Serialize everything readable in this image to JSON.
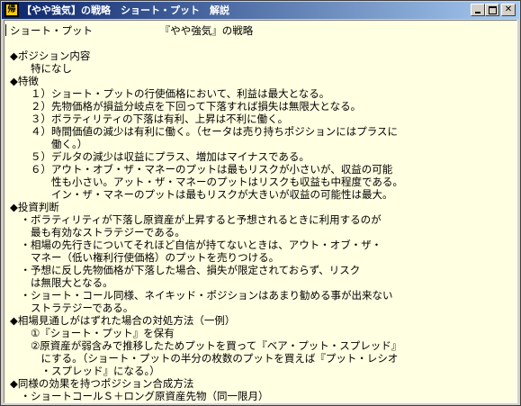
{
  "window": {
    "title": "【やや強気】の戦略　ショート・プット　解説",
    "icon_glyph": "帰",
    "icon": "app-icon",
    "controls": [
      "minimize-icon",
      "maximize-icon",
      "close-icon"
    ]
  },
  "content": {
    "lines": [
      "ショート・プット　　　　　　　『やや強気』の戦略",
      "",
      "◆ポジション内容",
      "　　特になし",
      "◆特徴",
      "　　１）ショート・プットの行使価格において、利益は最大となる。",
      "　　２）先物価格が損益分岐点を下回って下落すれば損失は無限大となる。",
      "　　３）ボラティリティの下落は有利、上昇は不利に働く。",
      "　　４）時間価値の減少は有利に働く。（セータは売り持ちポジションにはプラスに",
      "　　　　働く。）",
      "　　５）デルタの減少は収益にプラス、増加はマイナスである。",
      "　　６）アウト・オブ・ザ・マネーのプットは最もリスクが小さいが、収益の可能",
      "　　　　性も小さい。アット・ザ・マネーのプットはリスクも収益も中程度である。",
      "　　　　イン・ザ・マネーのプットは最もリスクが大きいが収益の可能性は最大。",
      "◆投資判断",
      "　・ボラティリティが下落し原資産が上昇すると予想されるときに利用するのが",
      "　　最も有効なストラテジーである。",
      "　・相場の先行きについてそれほど自信が持てないときは、アウト・オブ・ザ・",
      "　　マネー（低い権利行使価格）のプットを売りつける。",
      "　・予想に反し先物価格が下落した場合、損失が限定されておらず、リスク",
      "　　は無限大となる。",
      "　・ショート・コール同様、ネイキッド・ポジションはあまり勧める事が出来ない",
      "　　ストラテジーである。",
      "◆相場見通しがはずれた場合の対処方法（一例）",
      "　　①『ショート・プット』を保有",
      "　　②原資産が弱含みで推移したためプットを買って『ベア・プット・スプレッド』",
      "　　　にする。（ショート・プットの半分の枚数のプットを買えば『プット・レシオ",
      "　　　・スプレッド』になる。）",
      "◆同様の効果を持つポジション合成方法",
      "　・ショートコールＳ＋ロング原資産先物（同一限月）"
    ]
  }
}
